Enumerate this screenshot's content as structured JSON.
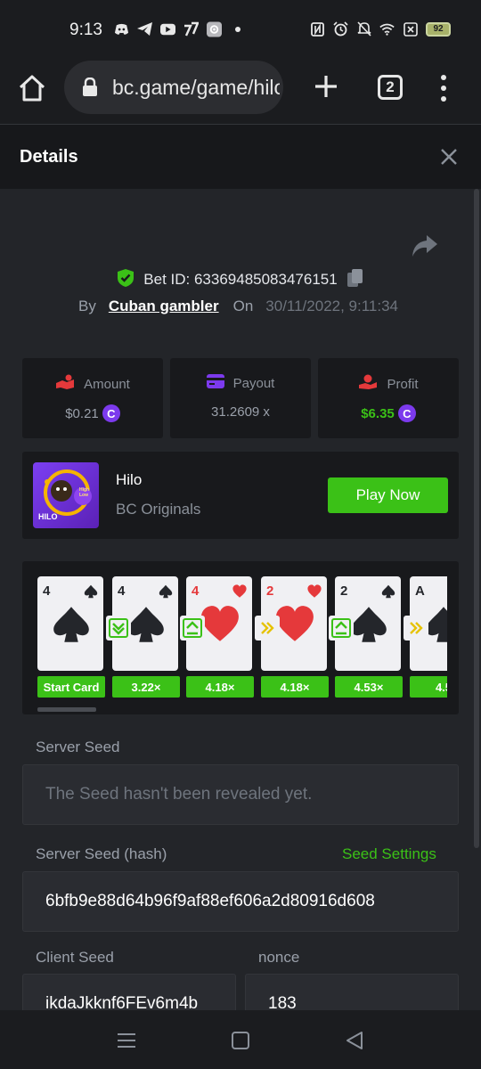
{
  "status_bar": {
    "time": "9:13",
    "battery": "92",
    "left_icons": [
      "discord-icon",
      "telegram-icon",
      "youtube-icon",
      "app-icon",
      "settings-app-icon",
      "dot-icon"
    ],
    "right_icons": [
      "nfc-icon",
      "alarm-icon",
      "mute-icon",
      "wifi-icon",
      "sim-icon"
    ]
  },
  "browser": {
    "url": "bc.game/game/hilo",
    "tab_count": "2"
  },
  "panel": {
    "title": "Details"
  },
  "bet": {
    "bet_id": "Bet ID: 63369485083476151",
    "by_label": "By",
    "user": "Cuban gambler",
    "on_label": "On",
    "date": "30/11/2022, 9:11:34"
  },
  "stats": {
    "amount_label": "Amount",
    "amount_value": "$0.21",
    "payout_label": "Payout",
    "payout_value": "31.2609 x",
    "profit_label": "Profit",
    "profit_value": "$6.35",
    "coin_symbol": "C"
  },
  "game": {
    "thumb_label": "HILO",
    "thumb_badge": "High Low",
    "name": "Hilo",
    "provider": "BC Originals",
    "play_label": "Play Now"
  },
  "cards": [
    {
      "rank": "4",
      "suit": "spade",
      "label": "Start Card"
    },
    {
      "rank": "4",
      "suit": "spade",
      "label": "3.22×"
    },
    {
      "rank": "4",
      "suit": "heart",
      "label": "4.18×"
    },
    {
      "rank": "2",
      "suit": "heart",
      "label": "4.18×"
    },
    {
      "rank": "2",
      "suit": "spade",
      "label": "4.53×"
    },
    {
      "rank": "A",
      "suit": "spade",
      "label": "4.5"
    }
  ],
  "arrows": [
    "lower",
    "higher",
    "skip",
    "higher",
    "skip"
  ],
  "colors": {
    "accent_green": "#3bc117",
    "heart_red": "#e5393b",
    "spade_dark": "#24262b",
    "coin_purple": "#7c3aed"
  },
  "seeds": {
    "server_seed_label": "Server Seed",
    "server_seed_value": "The Seed hasn't been revealed yet.",
    "server_hash_label": "Server Seed (hash)",
    "seed_settings_label": "Seed Settings",
    "server_hash_value": "6bfb9e88d64b96f9af88ef606a2d80916d608",
    "client_seed_label": "Client Seed",
    "client_seed_value": "ikdaJkknf6FEv6m4b",
    "nonce_label": "nonce",
    "nonce_value": "183"
  }
}
